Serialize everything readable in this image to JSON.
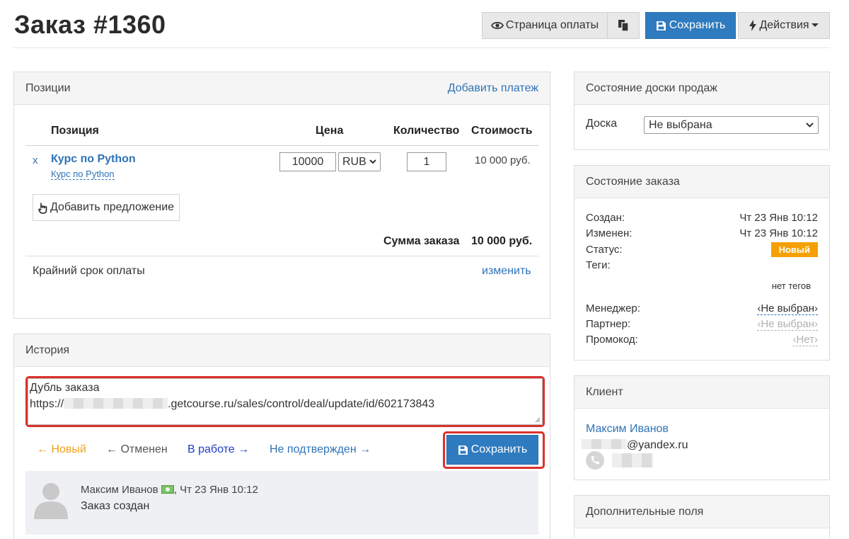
{
  "header": {
    "title": "Заказ #1360",
    "payment_page": "Страница оплаты",
    "save": "Сохранить",
    "actions": "Действия"
  },
  "positions": {
    "title": "Позиции",
    "add_payment": "Добавить платеж",
    "columns": [
      "Позиция",
      "Цена",
      "Количество",
      "Стоимость"
    ],
    "item": {
      "remove": "x",
      "name": "Курс по Python",
      "sub": "Курс по Python",
      "price": "10000",
      "currency": "RUB",
      "qty": "1",
      "cost": "10 000 руб."
    },
    "add_offer": "Добавить предложение",
    "sum_label": "Сумма заказа",
    "sum_value": "10 000 руб.",
    "deadline_label": "Крайний срок оплаты",
    "deadline_link": "изменить"
  },
  "history": {
    "title": "История",
    "comment_line1": "Дубль заказа",
    "comment_prefix": "https://",
    "comment_suffix": ".getcourse.ru/sales/control/deal/update/id/602173843",
    "status_new": "← Новый",
    "status_cancelled": "← Отменен",
    "status_in_work": "В работе →",
    "status_unconfirmed": "Не подтвержден →",
    "save": "Сохранить",
    "entry": {
      "author": "Максим Иванов",
      "time": ", Чт 23 Янв 10:12",
      "text": "Заказ создан"
    }
  },
  "board": {
    "title": "Состояние доски продаж",
    "label": "Доска",
    "selected": "Не выбрана"
  },
  "order_state": {
    "title": "Состояние заказа",
    "created_label": "Создан:",
    "created_value": "Чт 23 Янв 10:12",
    "modified_label": "Изменен:",
    "modified_value": "Чт 23 Янв 10:12",
    "status_label": "Статус:",
    "status_value": "Новый",
    "tags_label": "Теги:",
    "tags_value": "нет тегов",
    "manager_label": "Менеджер:",
    "manager_value": "‹Не выбран›",
    "partner_label": "Партнер:",
    "partner_value": "‹Не выбран›",
    "promo_label": "Промокод:",
    "promo_value": "‹Нет›"
  },
  "client": {
    "title": "Клиент",
    "name": "Максим Иванов",
    "email_suffix": "@yandex.ru"
  },
  "extra": {
    "title": "Дополнительные поля"
  },
  "colors": {
    "primary": "#2f7bbf",
    "link": "#2f73b6",
    "status_badge": "#f5a000",
    "highlight": "#d9322b",
    "status_new_link": "#f0a020"
  }
}
